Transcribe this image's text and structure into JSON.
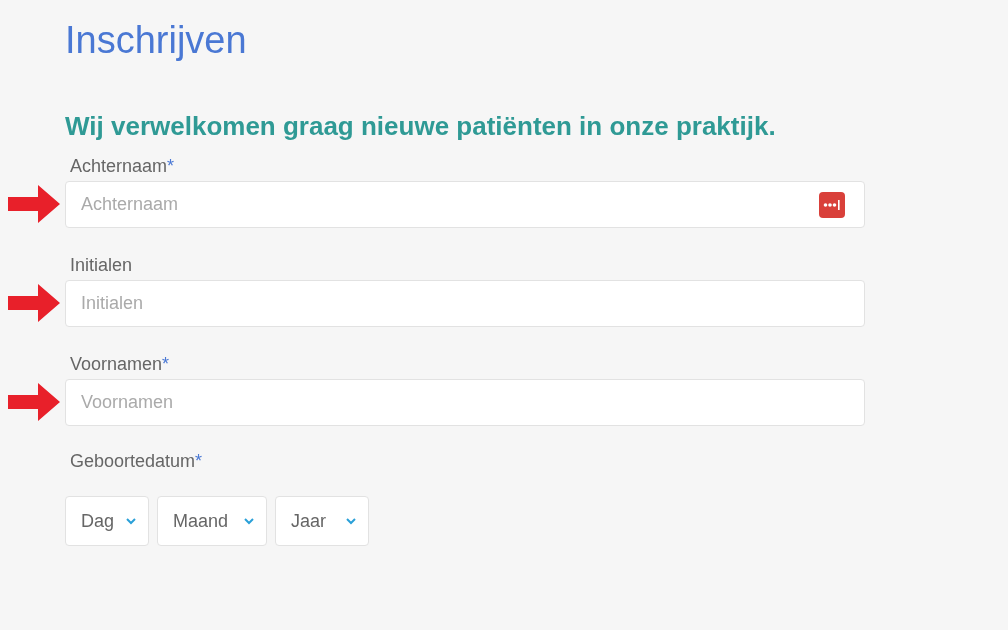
{
  "page_title": "Inschrijven",
  "intro": "Wij verwelkomen graag nieuwe patiënten in onze praktijk.",
  "fields": [
    {
      "label": "Achternaam",
      "required_mark": "*",
      "placeholder": "Achternaam",
      "arrow": true,
      "password_manager_icon": true
    },
    {
      "label": "Initialen",
      "placeholder": "Initialen",
      "arrow": true,
      "password_manager_icon": false
    },
    {
      "label": "Voornamen",
      "required_mark": "*",
      "placeholder": "Voornamen",
      "arrow": true,
      "password_manager_icon": false
    }
  ],
  "birthdate": {
    "label": "Geboortedatum",
    "required_mark": "*",
    "selects": [
      {
        "label": "Dag",
        "kind": "day"
      },
      {
        "label": "Maand",
        "kind": "month"
      },
      {
        "label": "Jaar",
        "kind": "year"
      }
    ]
  }
}
